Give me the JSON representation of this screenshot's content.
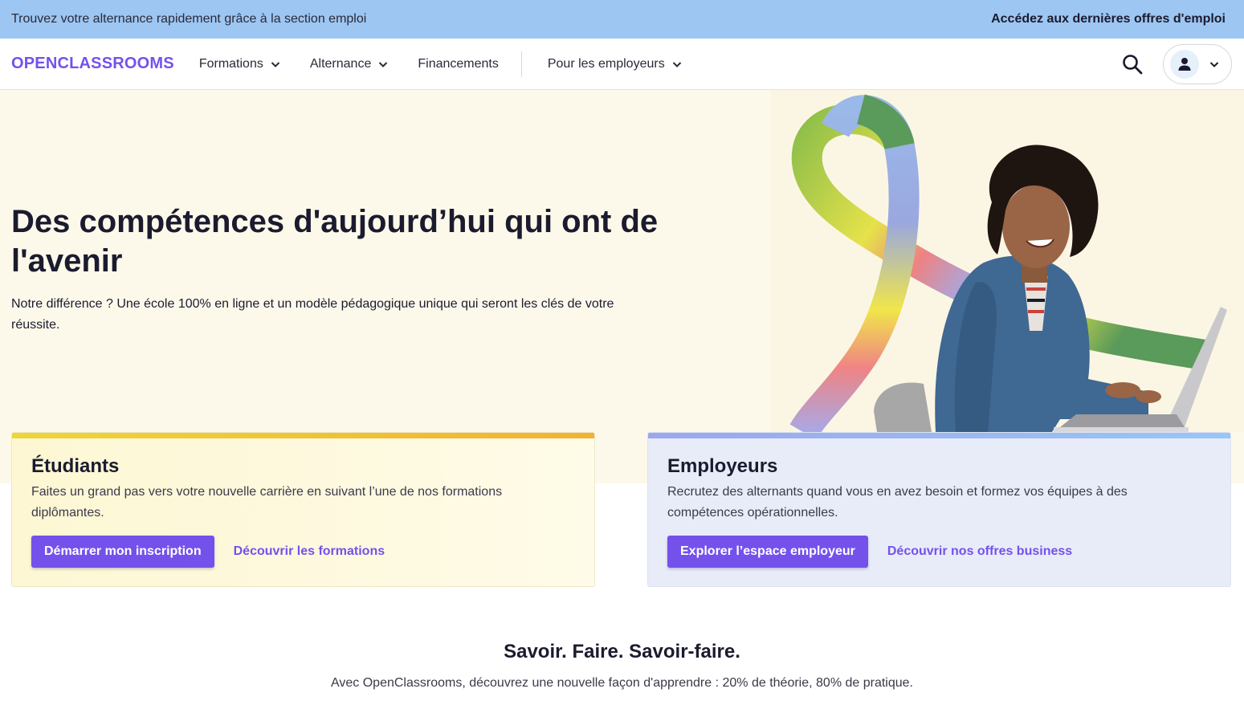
{
  "banner": {
    "text": "Trouvez votre alternance rapidement grâce à la section emploi",
    "link": "Accédez aux dernières offres d'emploi"
  },
  "nav": {
    "logo": "OPENCLASSROOMS",
    "items": [
      {
        "label": "Formations",
        "has_dropdown": true
      },
      {
        "label": "Alternance",
        "has_dropdown": true
      },
      {
        "label": "Financements",
        "has_dropdown": false
      },
      {
        "label": "Pour les employeurs",
        "has_dropdown": true
      }
    ],
    "icons": {
      "search": "search-icon",
      "account": "user-icon",
      "dropdown": "chevron-down-icon"
    }
  },
  "hero": {
    "title": "Des compétences d'aujourd’hui qui ont de l'avenir",
    "subtitle": "Notre différence ? Une école 100% en ligne et un modèle pédagogique unique qui seront les clés de votre réussite."
  },
  "cards": {
    "students": {
      "title": "Étudiants",
      "text": "Faites un grand pas vers votre nouvelle carrière en suivant l’une de nos formations diplômantes.",
      "primary": "Démarrer mon inscription",
      "secondary": "Découvrir les formations"
    },
    "employers": {
      "title": "Employeurs",
      "text": "Recrutez des alternants quand vous en avez besoin et formez vos équipes à des compétences opérationnelles.",
      "primary": "Explorer l’espace employeur",
      "secondary": "Découvrir nos offres business"
    }
  },
  "section": {
    "title": "Savoir. Faire. Savoir-faire.",
    "subtitle": "Avec OpenClassrooms, découvrez une nouvelle façon d'apprendre : 20% de théorie, 80% de pratique."
  },
  "colors": {
    "brand": "#7451eb",
    "banner": "#9dc6f2",
    "hero_bg": "#fdf9ea",
    "text": "#1b1b2f"
  }
}
